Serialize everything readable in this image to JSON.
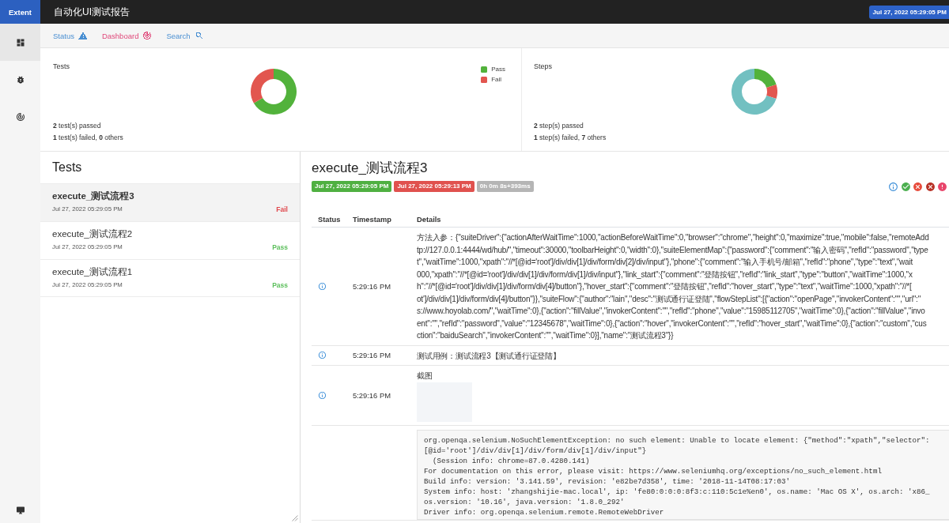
{
  "app": {
    "logo": "Extent",
    "title": "自动化UI测试报告",
    "date": "Jul 27, 2022 05:29:05 PM"
  },
  "sidebar": {
    "items": [
      {
        "kind": "tests",
        "selected": true
      },
      {
        "kind": "exceptions",
        "selected": false
      },
      {
        "kind": "dashboard",
        "selected": false
      }
    ]
  },
  "nav": [
    {
      "kind": "status",
      "label": "Status",
      "color": "#4a8fd2"
    },
    {
      "kind": "dashboard",
      "label": "Dashboard",
      "color": "#e0487a"
    },
    {
      "kind": "search",
      "label": "Search",
      "color": "#4a8fd2"
    }
  ],
  "summary": [
    {
      "title": "Tests",
      "chart_data": {
        "type": "donut",
        "categories": [
          "Pass",
          "Fail"
        ],
        "values": [
          66.7,
          33.3
        ]
      },
      "slices": [
        {
          "color": "#52b23b"
        },
        {
          "color": "#e2564f"
        }
      ],
      "lines": [
        "**2** test(s) passed",
        "**1** test(s) failed, **0** others"
      ]
    },
    {
      "title": "Steps",
      "chart_data": {
        "type": "donut",
        "values": [
          20,
          10,
          70
        ]
      },
      "slices": [
        {
          "color": "#52b23b"
        },
        {
          "color": "#e2564f"
        },
        {
          "color": "#72c0c1"
        }
      ],
      "lines": [
        "**2** step(s) passed",
        "**1** step(s) failed, **7** others"
      ]
    }
  ],
  "test_list": {
    "title": "Tests",
    "items": [
      {
        "name": "execute_测试流程3",
        "time": "Jul 27, 2022 05:29:05 PM",
        "status": "Fail",
        "color": "#e0474c",
        "selected": true
      },
      {
        "name": "execute_测试流程2",
        "time": "Jul 27, 2022 05:29:05 PM",
        "status": "Pass",
        "color": "#5cbf5c",
        "selected": false
      },
      {
        "name": "execute_测试流程1",
        "time": "Jul 27, 2022 05:29:05 PM",
        "status": "Pass",
        "color": "#5cbf5c",
        "selected": false
      }
    ]
  },
  "test_detail": {
    "title": "execute_测试流程3",
    "badges": [
      {
        "text": "Jul 27, 2022 05:29:05 PM",
        "color": "#4fb041"
      },
      {
        "text": "Jul 27, 2022 05:29:13 PM",
        "color": "#e0514e"
      },
      {
        "text": "0h 0m 8s+393ms",
        "color": "#b5b5b5"
      }
    ],
    "columns": [
      "Status",
      "Timestamp",
      "Details"
    ],
    "rows": [
      {
        "kind": "text",
        "time": "5:29:16 PM",
        "lines": [
          "方法入参：{\"suiteDriver\":{\"actionAfterWaitTime\":1000,\"actionBeforeWaitTime\":0,\"browser\":\"chrome\",\"height\":0,\"maximize\":true,\"mobile\":false,\"remoteAdd",
          "tp://127.0.0.1:4444/wd/hub/\",\"timeout\":30000,\"toolbarHeight\":0,\"width\":0},\"suiteElementMap\":{\"password\":{\"comment\":\"输入密码\",\"refId\":\"password\",\"type",
          "t\",\"waitTime\":1000,\"xpath\":\"//*[@id='root']/div/div[1]/div/form/div[2]/div/input\"},\"phone\":{\"comment\":\"输入手机号/邮箱\",\"refId\":\"phone\",\"type\":\"text\",\"wait",
          "000,\"xpath\":\"//*[@id='root']/div/div[1]/div/form/div[1]/div/input\"},\"link_start\":{\"comment\":\"登陆按钮\",\"refId\":\"link_start\",\"type\":\"button\",\"waitTime\":1000,\"x",
          "h\":\"//*[@id='root']/div/div[1]/div/form/div[4]/button\"},\"hover_start\":{\"comment\":\"登陆按钮\",\"refId\":\"hover_start\",\"type\":\"text\",\"waitTime\":1000,\"xpath\":\"//*[",
          "ot']/div/div[1]/div/form/div[4]/button\"}},\"suiteFlow\":{\"author\":\"lain\",\"desc\":\"测试通行证登陆\",\"flowStepList\":[{\"action\":\"openPage\",\"invokerContent\":\"\",\"url\":\"",
          "s://www.hoyolab.com/\",\"waitTime\":0},{\"action\":\"fillValue\",\"invokerContent\":\"\",\"refId\":\"phone\",\"value\":\"15985112705\",\"waitTime\":0},{\"action\":\"fillValue\",\"invo",
          "ent\":\"\",\"refId\":\"password\",\"value\":\"12345678\",\"waitTime\":0},{\"action\":\"hover\",\"invokerContent\":\"\",\"refId\":\"hover_start\",\"waitTime\":0},{\"action\":\"custom\",\"cus",
          "ction\":\"baiduSearch\",\"invokerContent\":\"\",\"waitTime\":0}],\"name\":\"测试流程3\"}}"
        ]
      },
      {
        "kind": "text",
        "time": "5:29:16 PM",
        "lines": [
          "测试用例：测试流程3【测试通行证登陆】"
        ]
      },
      {
        "kind": "image",
        "time": "5:29:16 PM",
        "caption": "截图"
      },
      {
        "kind": "code",
        "lines": [
          "org.openqa.selenium.NoSuchElementException: no such element: Unable to locate element: {\"method\":\"xpath\",\"selector\":",
          "[@id='root']/div/div[1]/div/form/div[1]/div/input\"}",
          "  (Session info: chrome=87.0.4280.141)",
          "For documentation on this error, please visit: https://www.seleniumhq.org/exceptions/no_such_element.html",
          "Build info: version: '3.141.59', revision: 'e82be7d358', time: '2018-11-14T08:17:03'",
          "System info: host: 'zhangshijie-mac.local', ip: 'fe80:0:0:0:8f3:c:110:5c1e%en0', os.name: 'Mac OS X', os.arch: 'x86_",
          "os.version: '10.16', java.version: '1.8.0_292'",
          "Driver info: org.openqa.selenium.remote.RemoteWebDriver"
        ]
      }
    ]
  }
}
